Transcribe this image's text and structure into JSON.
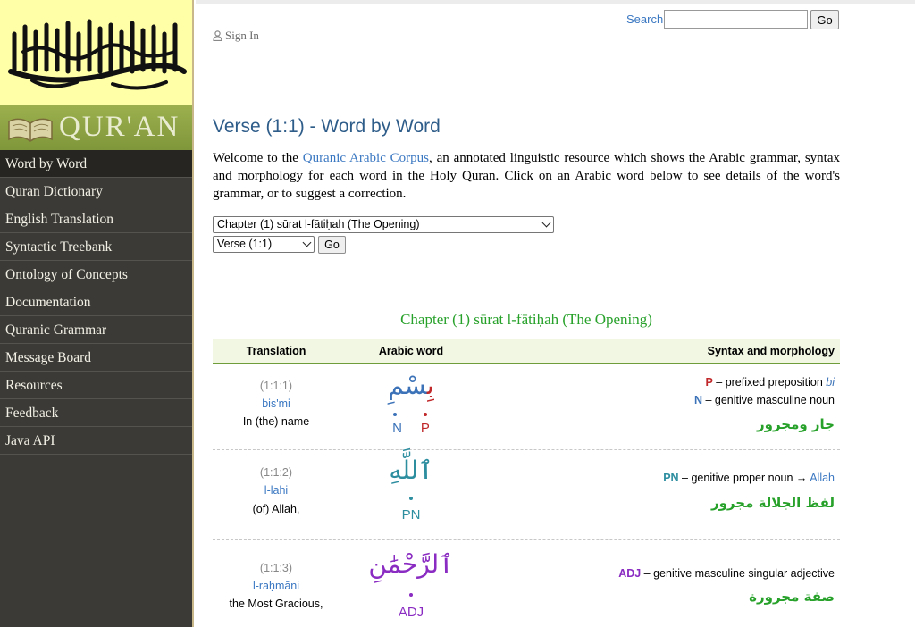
{
  "sidebar": {
    "banner_title": "QUR'AN",
    "items": [
      {
        "label": "Word by Word",
        "active": true
      },
      {
        "label": "Quran Dictionary"
      },
      {
        "label": "English Translation"
      },
      {
        "label": "Syntactic Treebank"
      },
      {
        "label": "Ontology of Concepts"
      },
      {
        "label": "Documentation"
      },
      {
        "label": "Quranic Grammar"
      },
      {
        "label": "Message Board"
      },
      {
        "label": "Resources"
      },
      {
        "label": "Feedback"
      },
      {
        "label": "Java API"
      }
    ]
  },
  "header": {
    "search_label": "Search",
    "search_value": "",
    "search_go": "Go",
    "signin": "Sign In"
  },
  "main": {
    "title": "Verse (1:1) - Word by Word",
    "intro_before": "Welcome to the ",
    "intro_link": "Quranic Arabic Corpus",
    "intro_after": ", an annotated linguistic resource which shows the Arabic grammar, syntax and morphology for each word in the Holy Quran. Click on an Arabic word below to see details of the word's grammar, or to suggest a correction.",
    "chapter_select": "Chapter (1) sūrat l-fātiḥah (The Opening)",
    "verse_select": "Verse (1:1)",
    "verse_go": "Go",
    "chapter_heading": "Chapter (1) sūrat l-fātiḥah (The Opening)"
  },
  "table": {
    "headers": {
      "translation": "Translation",
      "arabic": "Arabic word",
      "syntax": "Syntax and morphology"
    },
    "rows": [
      {
        "location": "(1:1:1)",
        "transliteration": "bis'mi",
        "translation": "In (the) name",
        "arabic_parts": [
          "بِ",
          "سْمِ"
        ],
        "tags": [
          "N",
          "P"
        ],
        "morph": [
          {
            "tag": "P",
            "text": " – prefixed preposition ",
            "extra": "bi"
          },
          {
            "tag": "N",
            "text": " – genitive masculine noun"
          }
        ],
        "arabic_desc": "جار ومجرور"
      },
      {
        "location": "(1:1:2)",
        "transliteration": "l-lahi",
        "translation": "(of) Allah,",
        "arabic_parts": [
          "ٱللَّهِ"
        ],
        "tags": [
          "PN"
        ],
        "morph": [
          {
            "tag": "PN",
            "text": " – genitive proper noun → ",
            "extra": "Allah"
          }
        ],
        "arabic_desc": "لفظ الجلالة مجرور"
      },
      {
        "location": "(1:1:3)",
        "transliteration": "l-raḥmāni",
        "translation": "the Most Gracious,",
        "arabic_parts": [
          "ٱلرَّحْمَٰنِ"
        ],
        "tags": [
          "ADJ"
        ],
        "morph": [
          {
            "tag": "ADJ",
            "text": " – genitive masculine singular adjective"
          }
        ],
        "arabic_desc": "صفة مجرورة"
      }
    ]
  },
  "colors": {
    "P": "#c0282a",
    "N": "#3c73b8",
    "PN": "#2d8ea0",
    "ADJ": "#8a2bc2",
    "green": "#27a12a"
  }
}
